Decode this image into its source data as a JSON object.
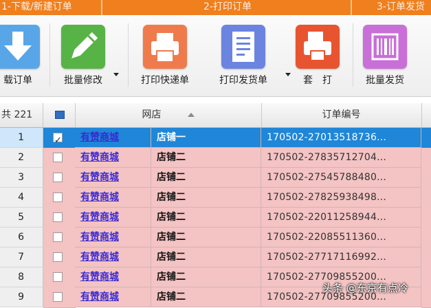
{
  "steps": [
    {
      "label": "1-下载/新建订单"
    },
    {
      "label": "2-打印订单"
    },
    {
      "label": "3-订单发货"
    }
  ],
  "toolbar": {
    "items": [
      {
        "label": "载订单",
        "icon": "download-icon",
        "color": "#58a6e8"
      },
      {
        "label": "批量修改",
        "icon": "pencil-icon",
        "color": "#57b346"
      },
      {
        "label": "打印快递单",
        "icon": "printer-icon",
        "color": "#ef7b4d"
      },
      {
        "label": "打印发货单",
        "icon": "invoice-icon",
        "color": "#6b84e0"
      },
      {
        "label": "套　打",
        "icon": "combined-print-icon",
        "color": "#e8542f"
      },
      {
        "label": "批量发货",
        "icon": "barcode-icon",
        "color": "#c86fd8"
      }
    ]
  },
  "grid": {
    "row_count_label": "共 221",
    "columns": {
      "shop": "网店",
      "order_no": "订单编号"
    },
    "rows": [
      {
        "num": "1",
        "checked": true,
        "shop": "有赞商城",
        "store": "店铺一",
        "order_no": "170502-27013518736..."
      },
      {
        "num": "2",
        "checked": false,
        "shop": "有赞商城",
        "store": "店铺二",
        "order_no": "170502-27835712704..."
      },
      {
        "num": "3",
        "checked": false,
        "shop": "有赞商城",
        "store": "店铺二",
        "order_no": "170502-27545788480..."
      },
      {
        "num": "4",
        "checked": false,
        "shop": "有赞商城",
        "store": "店铺二",
        "order_no": "170502-27825938498..."
      },
      {
        "num": "5",
        "checked": false,
        "shop": "有赞商城",
        "store": "店铺二",
        "order_no": "170502-22011258944..."
      },
      {
        "num": "6",
        "checked": false,
        "shop": "有赞商城",
        "store": "店铺二",
        "order_no": "170502-22085511360..."
      },
      {
        "num": "7",
        "checked": false,
        "shop": "有赞商城",
        "store": "店铺二",
        "order_no": "170502-27717116992..."
      },
      {
        "num": "8",
        "checked": false,
        "shop": "有赞商城",
        "store": "店铺二",
        "order_no": "170502-27709855200..."
      },
      {
        "num": "9",
        "checked": false,
        "shop": "有赞商城",
        "store": "店铺二",
        "order_no": "170502-27709855200..."
      }
    ]
  },
  "watermark": "头条 @东京有点冷"
}
